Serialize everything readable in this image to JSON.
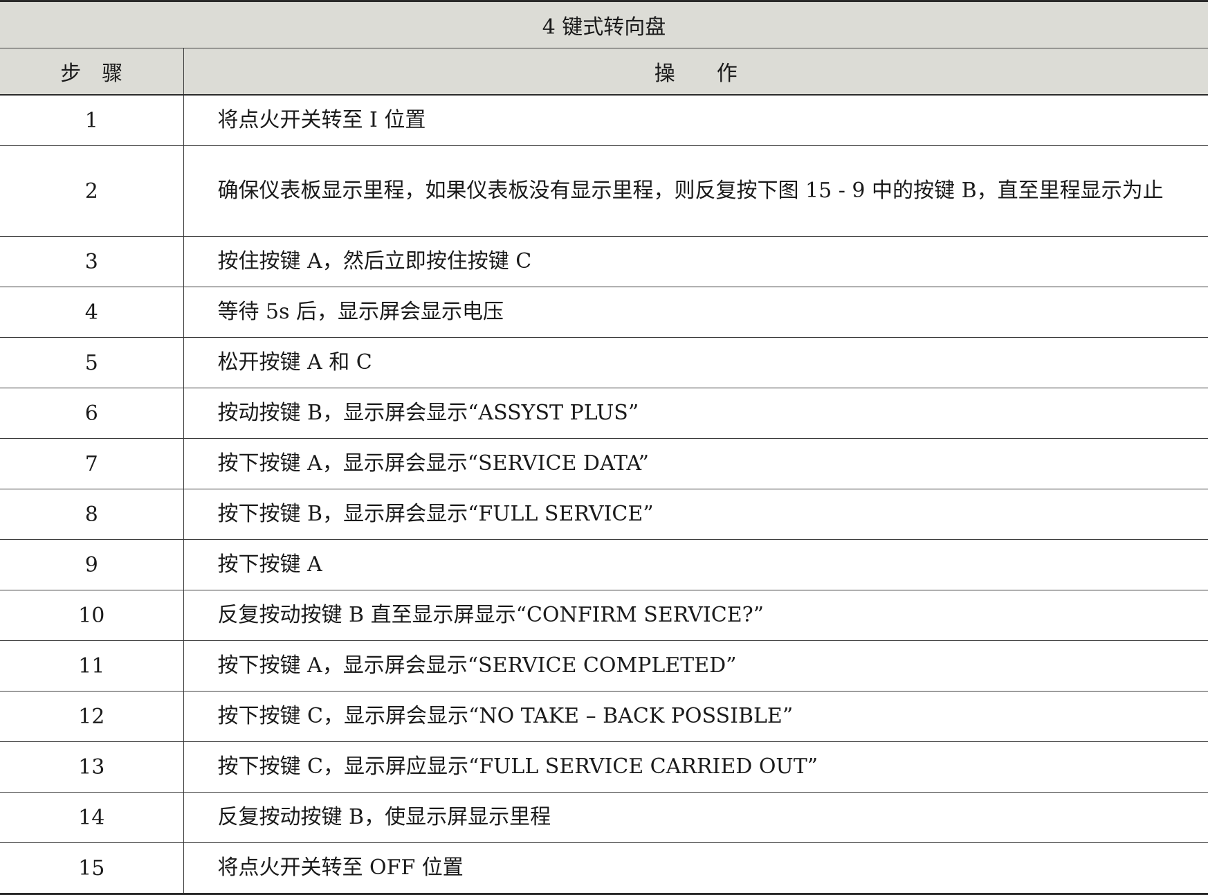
{
  "table": {
    "title": "4 键式转向盘",
    "headers": {
      "step": "步骤",
      "operation": "操作"
    },
    "rows": [
      {
        "step": "1",
        "operation": "将点火开关转至 I 位置"
      },
      {
        "step": "2",
        "operation": "确保仪表板显示里程，如果仪表板没有显示里程，则反复按下图 15 - 9 中的按键 B，直至里程显示为止"
      },
      {
        "step": "3",
        "operation": "按住按键 A，然后立即按住按键 C"
      },
      {
        "step": "4",
        "operation": "等待 5s 后，显示屏会显示电压"
      },
      {
        "step": "5",
        "operation": "松开按键 A 和 C"
      },
      {
        "step": "6",
        "operation": "按动按键 B，显示屏会显示“ASSYST PLUS”"
      },
      {
        "step": "7",
        "operation": "按下按键 A，显示屏会显示“SERVICE DATA”"
      },
      {
        "step": "8",
        "operation": "按下按键 B，显示屏会显示“FULL SERVICE”"
      },
      {
        "step": "9",
        "operation": "按下按键 A"
      },
      {
        "step": "10",
        "operation": "反复按动按键 B 直至显示屏显示“CONFIRM SERVICE?”"
      },
      {
        "step": "11",
        "operation": "按下按键 A，显示屏会显示“SERVICE COMPLETED”"
      },
      {
        "step": "12",
        "operation": "按下按键 C，显示屏会显示“NO TAKE – BACK POSSIBLE”"
      },
      {
        "step": "13",
        "operation": "按下按键 C，显示屏应显示“FULL SERVICE CARRIED OUT”"
      },
      {
        "step": "14",
        "operation": "反复按动按键 B，使显示屏显示里程"
      },
      {
        "step": "15",
        "operation": "将点火开关转至 OFF 位置"
      }
    ]
  }
}
